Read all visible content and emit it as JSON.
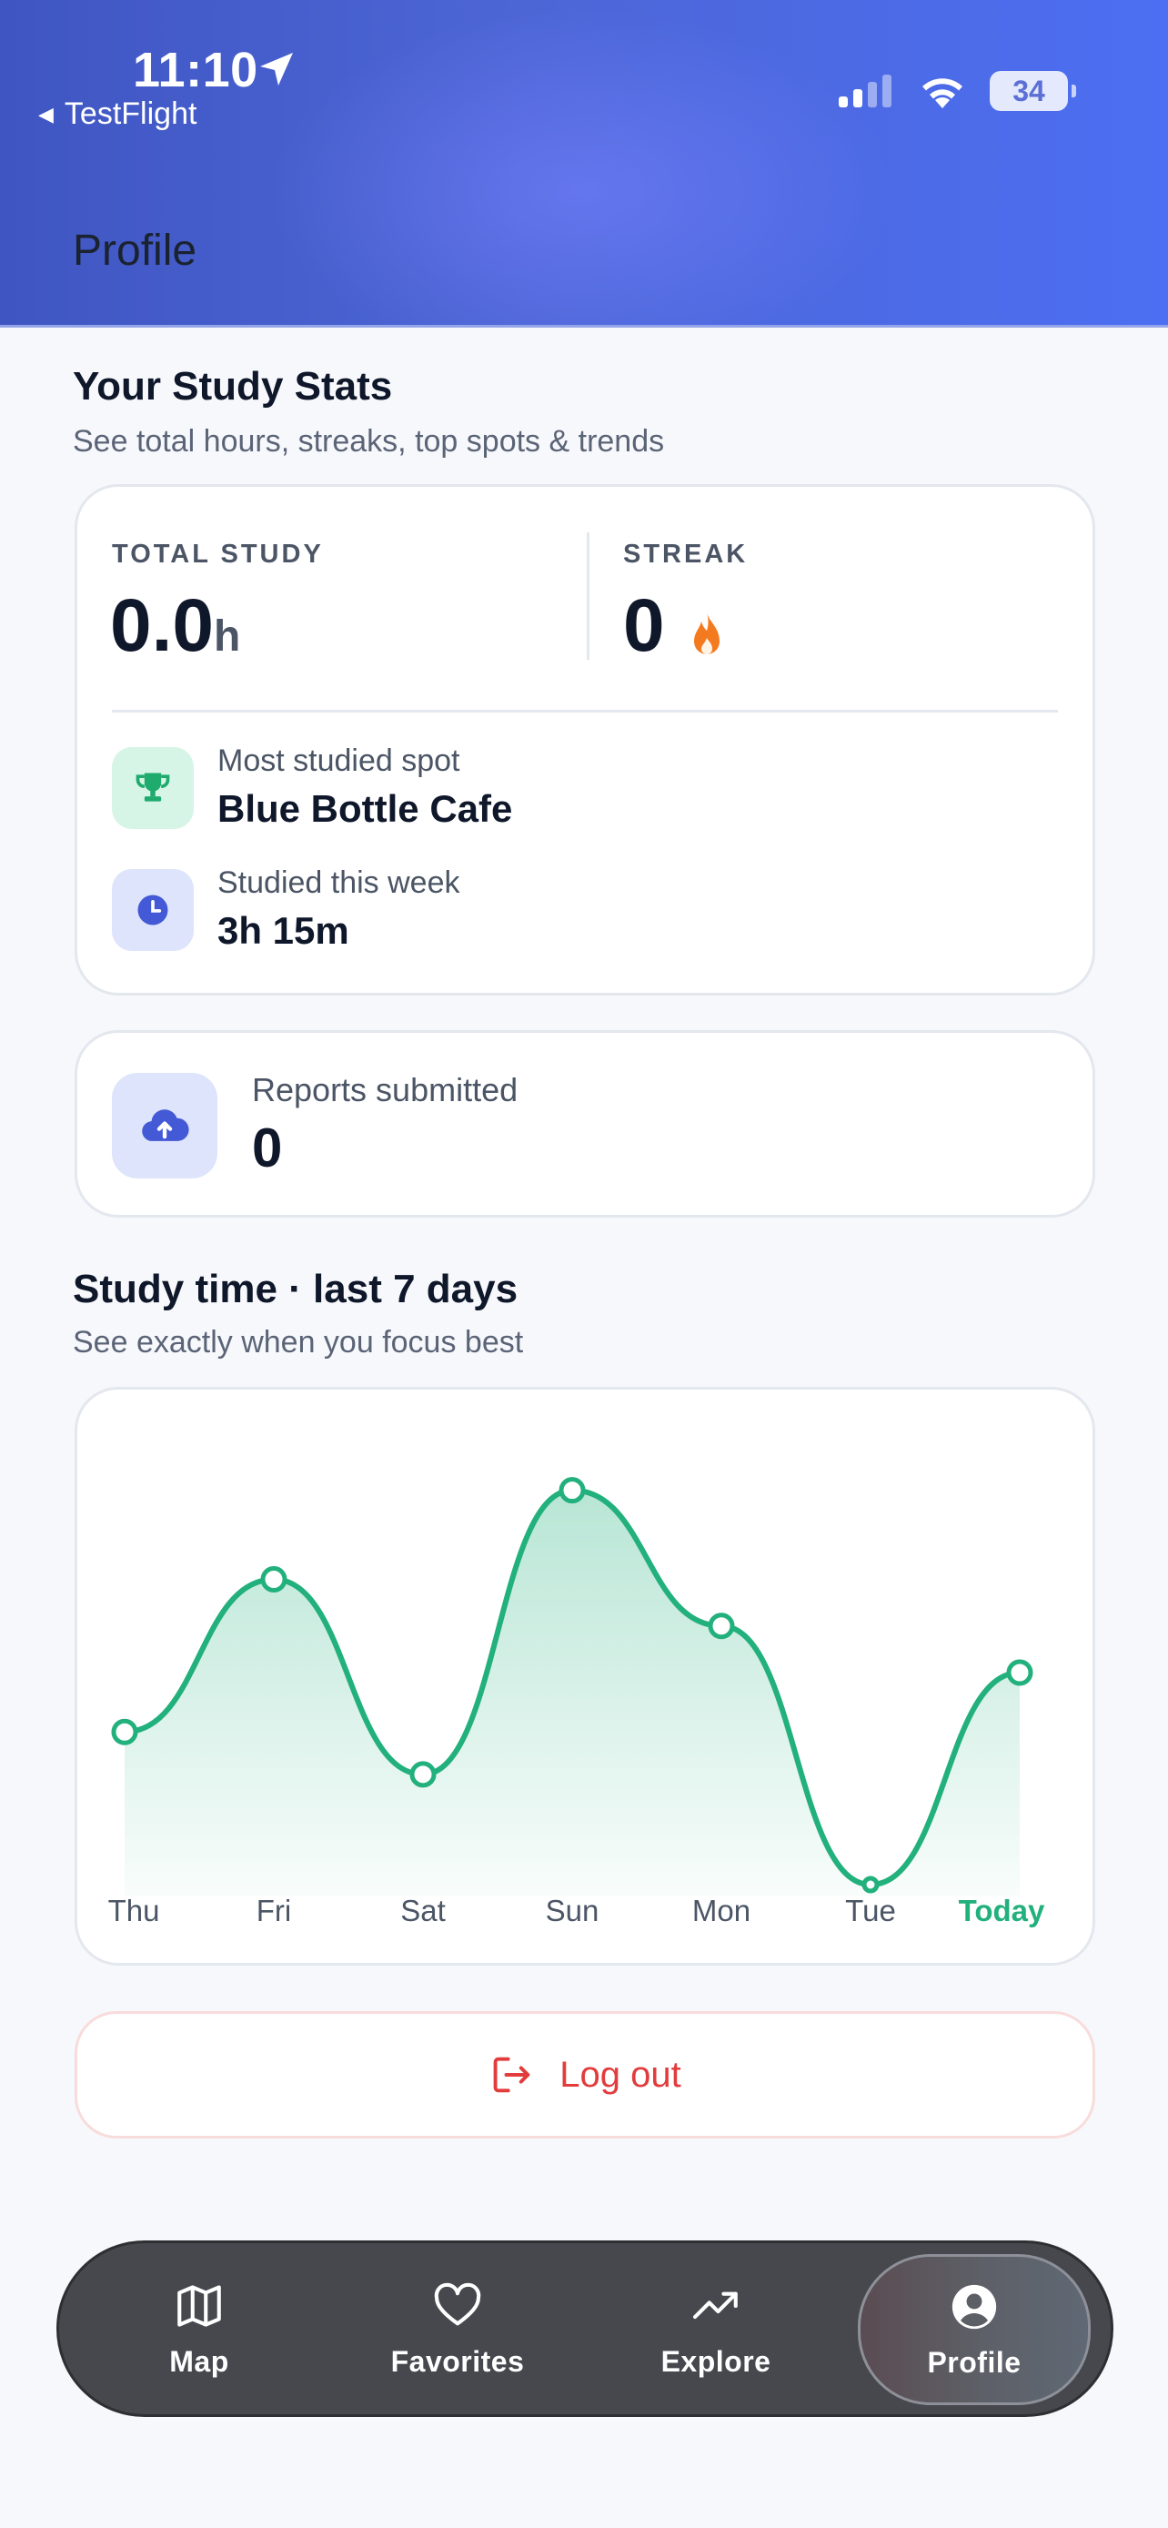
{
  "status_bar": {
    "time": "11:10",
    "back_app": "TestFlight",
    "battery": "34"
  },
  "header": {
    "title": "Profile"
  },
  "stats": {
    "title": "Your Study Stats",
    "subtitle": "See total hours, streaks, top spots & trends",
    "total_label": "TOTAL STUDY",
    "total_value": "0.0",
    "total_unit": "h",
    "streak_label": "STREAK",
    "streak_value": "0",
    "top_spot_label": "Most studied spot",
    "top_spot_value": "Blue Bottle Cafe",
    "week_label": "Studied this week",
    "week_value": "3h 15m"
  },
  "reports": {
    "label": "Reports submitted",
    "value": "0"
  },
  "chart_section": {
    "title": "Study time · last 7 days",
    "subtitle": "See exactly when you focus best"
  },
  "chart_data": {
    "type": "area",
    "categories": [
      "Thu",
      "Fri",
      "Sat",
      "Sun",
      "Mon",
      "Tue",
      "Today"
    ],
    "values": [
      0.36,
      0.72,
      0.26,
      0.93,
      0.61,
      0.0,
      0.5
    ],
    "ylim": [
      0,
      1
    ],
    "grid": false,
    "line_color": "#22b07d",
    "highlight_category": "Today"
  },
  "logout": {
    "label": "Log out"
  },
  "tabbar": {
    "items": [
      {
        "label": "Map",
        "icon": "map-icon"
      },
      {
        "label": "Favorites",
        "icon": "heart-icon"
      },
      {
        "label": "Explore",
        "icon": "trending-up-icon"
      },
      {
        "label": "Profile",
        "icon": "user-circle-icon"
      }
    ],
    "active": "Profile"
  },
  "colors": {
    "accent_green": "#22b07d",
    "danger": "#e23c3c",
    "flame": "#f47a20",
    "blue": "#4459d6"
  }
}
